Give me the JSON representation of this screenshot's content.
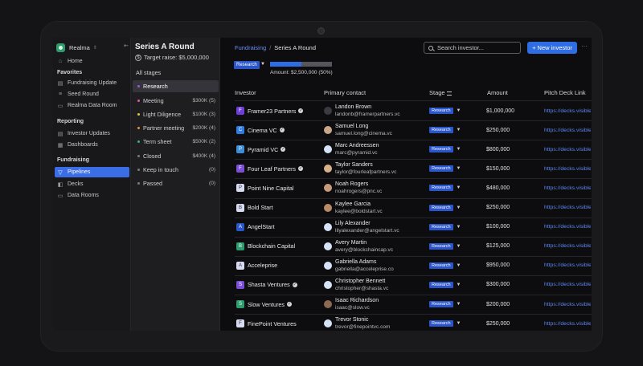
{
  "workspace": {
    "name": "Realma",
    "home": "Home"
  },
  "sidebar": {
    "favorites_label": "Favorites",
    "favorites": [
      "Fundraising Update",
      "Seed Round",
      "Realma Data Room"
    ],
    "reporting_label": "Reporting",
    "reporting": [
      "Investor Updates",
      "Dashboards"
    ],
    "fundraising_label": "Fundraising",
    "fundraising": [
      "Pipelines",
      "Decks",
      "Data Rooms"
    ]
  },
  "round": {
    "title": "Series A Round",
    "target": "Target raise: $5,000,000"
  },
  "stages": [
    {
      "label": "All stages",
      "count": "",
      "color": ""
    },
    {
      "label": "Research",
      "count": "",
      "color": "#9b59d9"
    },
    {
      "label": "Meeting",
      "count": "$300K (5)",
      "color": "#e05a9c"
    },
    {
      "label": "Light Diligence",
      "count": "$100K (3)",
      "color": "#e8c340"
    },
    {
      "label": "Partner meeting",
      "count": "$200K (4)",
      "color": "#e8913a"
    },
    {
      "label": "Term sheet",
      "count": "$500K (2)",
      "color": "#36b37e"
    },
    {
      "label": "Closed",
      "count": "$400K (4)",
      "color": "#7a7a80"
    },
    {
      "label": "Keep in touch",
      "count": "(0)",
      "color": "#7a7a80"
    },
    {
      "label": "Passed",
      "count": "(0)",
      "color": "#7a7a80"
    }
  ],
  "header": {
    "breadcrumb_root": "Fundraising",
    "breadcrumb_sep": "/",
    "breadcrumb_current": "Series A Round",
    "search_placeholder": "Search investor...",
    "new_button": "+ New investor",
    "more": "···"
  },
  "summary": {
    "stage": "Research",
    "progress": 0.5,
    "amount": "Amount: $2,500,000 (50%)"
  },
  "table": {
    "columns": [
      "Investor",
      "Primary contact",
      "Stage",
      "Amount",
      "Pitch Deck Link"
    ],
    "rows": [
      {
        "investor": "Framer23 Partners",
        "verified": true,
        "logo": "#6d3fd8",
        "contact": "Landon Brown",
        "email": "landonb@framerpartners.vc",
        "avatar": "#3a3a40",
        "stage": "Research",
        "amount": "$1,000,000",
        "link": "https://decks.visible"
      },
      {
        "investor": "Cinema VC",
        "verified": true,
        "logo": "#2f7de4",
        "contact": "Samuel Long",
        "email": "samuel.long@cinema.vc",
        "avatar": "#c9a58a",
        "stage": "Research",
        "amount": "$250,000",
        "link": "https://decks.visible"
      },
      {
        "investor": "Pyramid VC",
        "verified": true,
        "logo": "#3b8fd9",
        "contact": "Marc Andreessen",
        "email": "marc@pyramid.vc",
        "avatar": "#d6e2f5",
        "stage": "Research",
        "amount": "$800,000",
        "link": "https://decks.visible"
      },
      {
        "investor": "Four Leaf Partners",
        "verified": true,
        "logo": "#7b4fd8",
        "contact": "Taylor Sanders",
        "email": "taylor@fourleafpartners.vc",
        "avatar": "#d9b08c",
        "stage": "Research",
        "amount": "$150,000",
        "link": "https://decks.visible"
      },
      {
        "investor": "Point Nine Capital",
        "verified": false,
        "logo": "#d8dcf0",
        "contact": "Noah Rogers",
        "email": "noahrogers@pnc.vc",
        "avatar": "#c79a7a",
        "stage": "Research",
        "amount": "$480,000",
        "link": "https://decks.visible"
      },
      {
        "investor": "Bold Start",
        "verified": false,
        "logo": "#d8dcf0",
        "contact": "Kaylee Garcia",
        "email": "kaylee@boldstart.vc",
        "avatar": "#b98a6a",
        "stage": "Research",
        "amount": "$250,000",
        "link": "https://decks.visible"
      },
      {
        "investor": "AngelStart",
        "verified": false,
        "logo": "#2a56c9",
        "contact": "Lily Alexander",
        "email": "lilyalexander@angelstart.vc",
        "avatar": "#d6e2f5",
        "stage": "Research",
        "amount": "$100,000",
        "link": "https://decks.visible"
      },
      {
        "investor": "Blockchain Capital",
        "verified": false,
        "logo": "#2e9c6e",
        "contact": "Avery Martin",
        "email": "avery@blockchaincap.vc",
        "avatar": "#d6e2f5",
        "stage": "Research",
        "amount": "$125,000",
        "link": "https://decks.visible"
      },
      {
        "investor": "Acceleprise",
        "verified": false,
        "logo": "#d8dcf0",
        "contact": "Gabriella Adams",
        "email": "gabriella@acceleprise.co",
        "avatar": "#d6e2f5",
        "stage": "Research",
        "amount": "$950,000",
        "link": "https://decks.visible"
      },
      {
        "investor": "Shasta Ventures",
        "verified": true,
        "logo": "#7b4fd8",
        "contact": "Christopher Bennett",
        "email": "christopher@shasta.vc",
        "avatar": "#d6e2f5",
        "stage": "Research",
        "amount": "$300,000",
        "link": "https://decks.visible"
      },
      {
        "investor": "Slow Ventures",
        "verified": true,
        "logo": "#2e9c6e",
        "contact": "Isaac Richardson",
        "email": "isaac@slow.vc",
        "avatar": "#8a6a55",
        "stage": "Research",
        "amount": "$200,000",
        "link": "https://decks.visible"
      },
      {
        "investor": "FinePoint Ventures",
        "verified": false,
        "logo": "#d8dcf0",
        "contact": "Trevor Stonic",
        "email": "trevor@finepointvc.com",
        "avatar": "#d6e2f5",
        "stage": "Research",
        "amount": "$250,000",
        "link": "https://decks.visible"
      }
    ]
  }
}
